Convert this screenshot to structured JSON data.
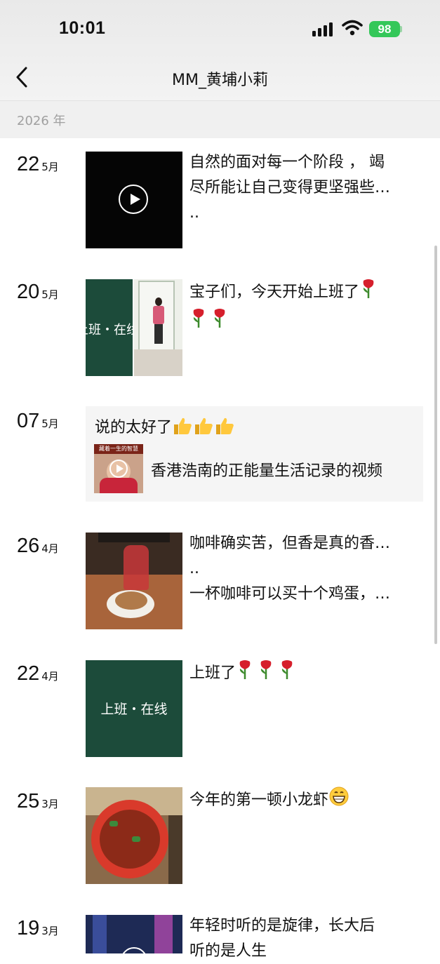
{
  "status_bar": {
    "time": "10:01",
    "battery": "98"
  },
  "header": {
    "title": "MM_黄埔小莉"
  },
  "year": "2026 年",
  "posts": [
    {
      "day": "22",
      "month": "5月",
      "lines": [
        "自然的面对每一个阶段 ， 竭",
        "尽所能让自己变得更坚强些…",
        ".."
      ]
    },
    {
      "day": "20",
      "month": "5月",
      "lines": [
        "宝子们，今天开始上班了"
      ],
      "thumb_text": "上班・在线"
    },
    {
      "day": "07",
      "month": "5月",
      "comment": "说的太好了",
      "share_title": "香港浩南的正能量生活记录的视频",
      "share_thumb_text": "藏着一生的智慧"
    },
    {
      "day": "26",
      "month": "4月",
      "lines": [
        "咖啡确实苦，但香是真的香…",
        "..",
        "一杯咖啡可以买十个鸡蛋，…"
      ]
    },
    {
      "day": "22",
      "month": "4月",
      "lines": [
        "上班了"
      ],
      "thumb_text": "上班・在线"
    },
    {
      "day": "25",
      "month": "3月",
      "lines": [
        "今年的第一顿小龙虾"
      ]
    },
    {
      "day": "19",
      "month": "3月",
      "lines": [
        "年轻时听的是旋律，长大后",
        "听的是人生"
      ]
    }
  ],
  "colors": {
    "battery": "#34c759",
    "thumb_green": "#1c4b3a"
  },
  "icons": [
    "back-chevron-icon",
    "signal-icon",
    "wifi-icon",
    "battery-icon",
    "play-icon",
    "rose-emoji",
    "thumbs-up-emoji",
    "grin-emoji"
  ]
}
